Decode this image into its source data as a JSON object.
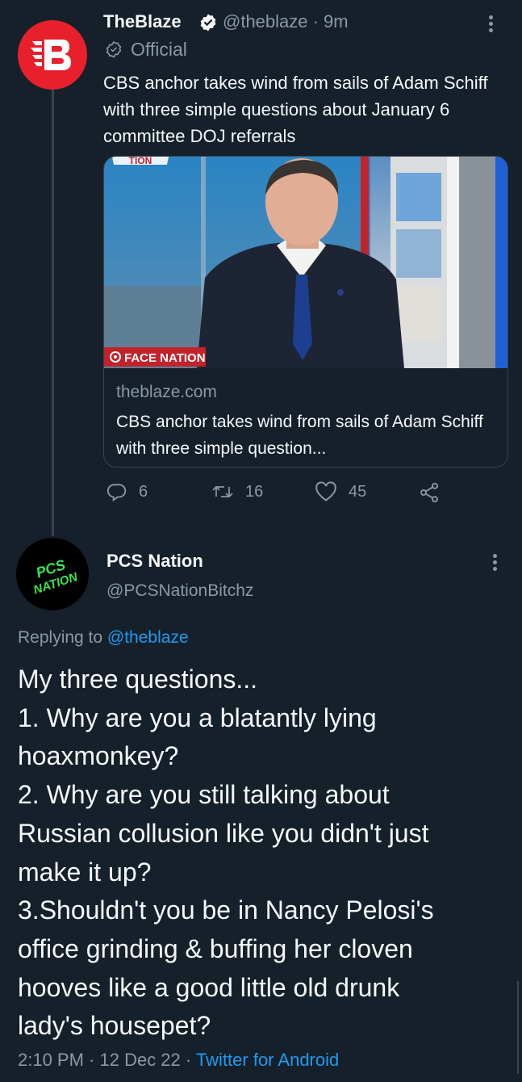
{
  "tweet": {
    "author_name": "TheBlaze",
    "author_handle": "@theblaze · 9m",
    "badge_label": "Official",
    "avatar_letter": "B",
    "text": "CBS anchor takes wind from sails of Adam Schiff with three simple questions about January 6 committee DOJ referrals",
    "card": {
      "image_overlay": "FACE NATION",
      "image_top_text": "TION",
      "domain": "theblaze.com",
      "title": "CBS anchor takes wind from sails of Adam Schiff with three simple question..."
    },
    "actions": {
      "replies": "6",
      "retweets": "16",
      "likes": "45"
    }
  },
  "reply": {
    "author_name": "PCS Nation",
    "author_handle": "@PCSNationBitchz",
    "avatar_text_line1": "PCS",
    "avatar_text_line2": "NATION",
    "replying_prefix": "Replying to ",
    "replying_handle": "@theblaze",
    "text_lines": [
      "My three questions...",
      "1. Why are you a blatantly lying",
      "hoaxmonkey?",
      "2. Why are you still talking about",
      "Russian collusion like you didn't just",
      "make it up?",
      "3.Shouldn't you be in Nancy Pelosi's",
      "office grinding & buffing her cloven",
      "hooves like a good little old drunk",
      "lady's housepet?"
    ],
    "timestamp": "2:10 PM · 12 Dec 22 · ",
    "source": "Twitter for Android"
  },
  "colors": {
    "background": "#15202b",
    "accent": "#1d9bf0",
    "blaze_red": "#e8202b",
    "pcs_green": "#39e64a"
  }
}
